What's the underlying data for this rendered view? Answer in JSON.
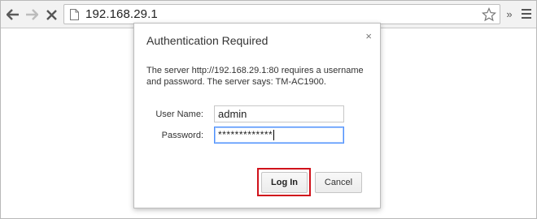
{
  "browser": {
    "url": "192.168.29.1",
    "icons": [
      "back-arrow-icon",
      "forward-arrow-icon",
      "stop-icon",
      "page-icon",
      "bookmark-star-icon",
      "overflow-chevron-icon",
      "menu-icon"
    ],
    "extensions_glyph": "»"
  },
  "dialog": {
    "title": "Authentication Required",
    "close_glyph": "×",
    "message": "The server http://192.168.29.1:80 requires a username and password. The server says: TM-AC1900.",
    "username_label": "User Name:",
    "username_value": "admin",
    "password_label": "Password:",
    "password_value": "*************",
    "login_label": "Log In",
    "cancel_label": "Cancel",
    "highlight_color": "#d0121b"
  }
}
